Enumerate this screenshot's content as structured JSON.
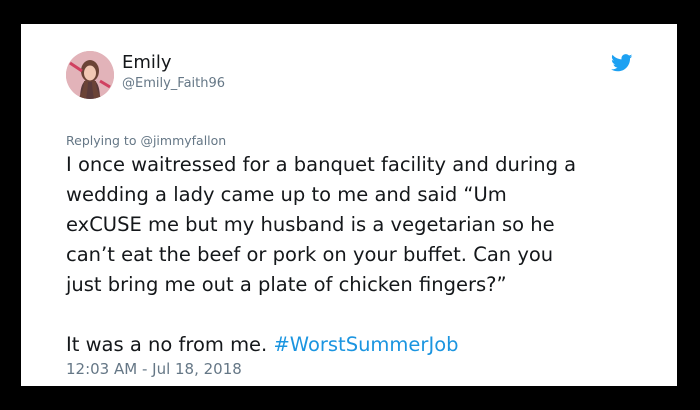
{
  "tweet": {
    "author_name": "Emily",
    "author_handle": "@Emily_Faith96",
    "replying_to": "Replying to @jimmyfallon",
    "lines": [
      "I once waitressed for a banquet facility and during a",
      "wedding a lady came up to me and said “Um",
      "exCUSE me but my husband is a vegetarian so he",
      "can’t eat the beef or pork on your buffet. Can you",
      "just bring me out a plate of chicken fingers?”"
    ],
    "closing_text": "It was a no from me. ",
    "hashtag": "#WorstSummerJob",
    "timestamp": "12:03 AM - Jul 18, 2018",
    "icon": "twitter-bird-icon"
  },
  "colors": {
    "background": "#000000",
    "card": "#ffffff",
    "text": "#14171a",
    "muted": "#657786",
    "accent": "#1b95e0",
    "twitter_blue": "#1da1f2"
  }
}
